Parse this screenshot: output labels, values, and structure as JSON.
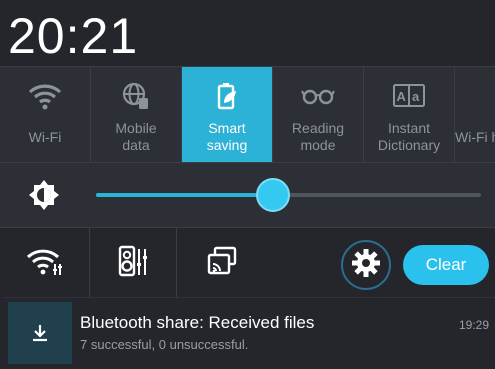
{
  "status": {
    "time": "20:21"
  },
  "quick_settings": {
    "tiles": [
      {
        "label": "Wi-Fi",
        "icon": "wifi-icon",
        "active": false
      },
      {
        "label": "Mobile\ndata",
        "icon": "globe-icon",
        "active": false
      },
      {
        "label": "Smart\nsaving",
        "icon": "battery-leaf-icon",
        "active": true
      },
      {
        "label": "Reading\nmode",
        "icon": "glasses-icon",
        "active": false
      },
      {
        "label": "Instant\nDictionary",
        "icon": "dictionary-icon",
        "active": false
      },
      {
        "label": "Wi-Fi h",
        "icon": "hotspot-icon",
        "active": false
      }
    ]
  },
  "brightness": {
    "level": 0.46,
    "icon": "brightness-icon"
  },
  "actions": {
    "wifi_settings_icon": "wifi-settings-icon",
    "audio_icon": "audio-wizard-icon",
    "cast_icon": "screen-cast-icon",
    "settings_icon": "gear-icon",
    "clear_label": "Clear"
  },
  "notification": {
    "title": "Bluetooth share: Received files",
    "subtitle": "7 successful, 0 unsuccessful.",
    "time": "19:29",
    "icon": "download-icon"
  },
  "colors": {
    "accent": "#2bb2d6",
    "panel": "#24262b",
    "tile_bg": "#2c2f35"
  }
}
